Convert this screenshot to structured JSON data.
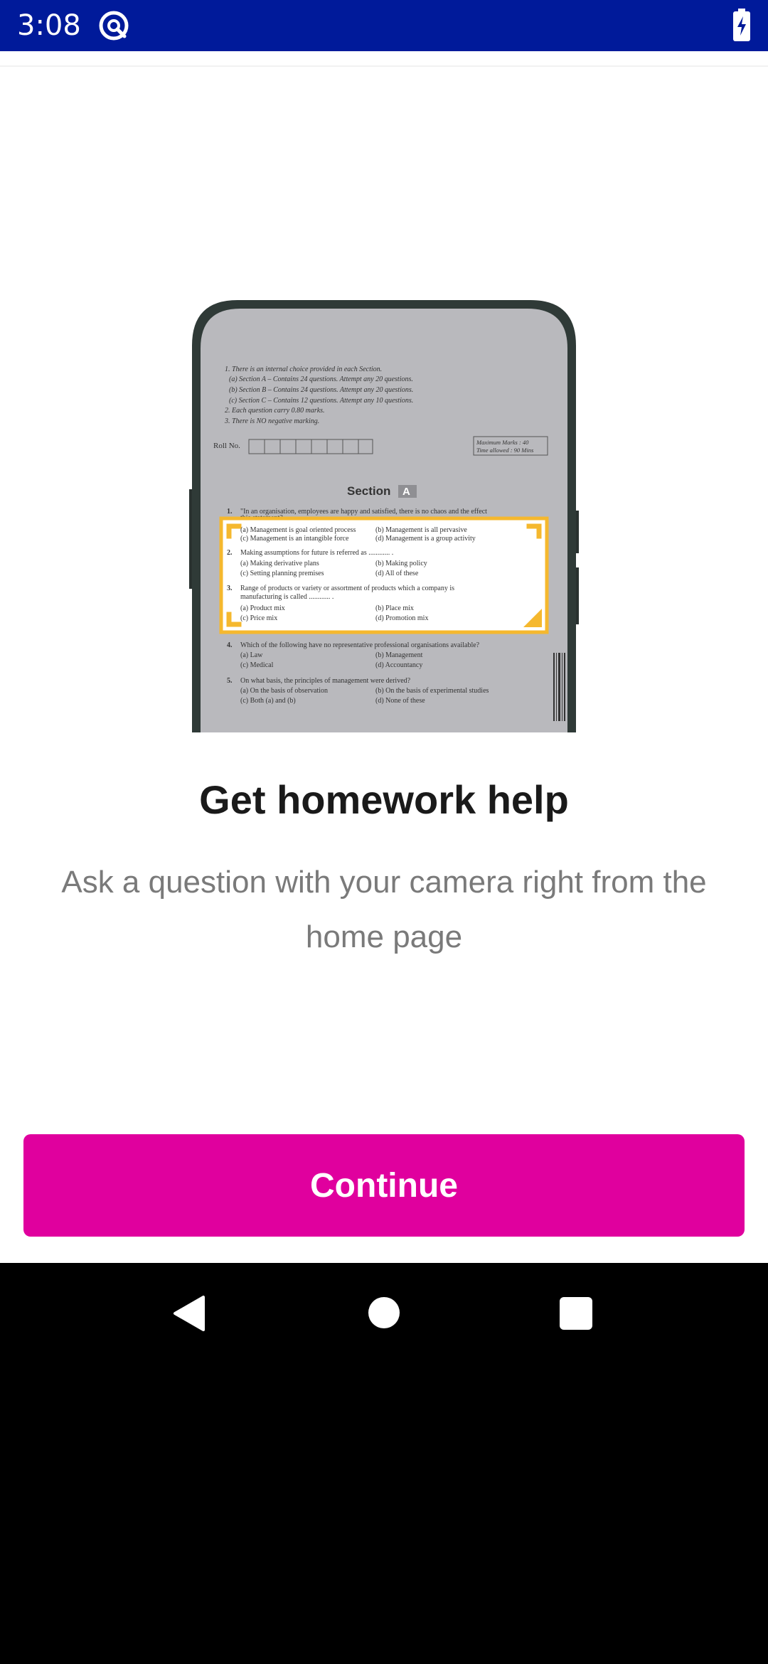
{
  "status_bar": {
    "time": "3:08",
    "icons": [
      "app-notification-icon",
      "battery-charging-icon"
    ],
    "background_color": "#001a9a"
  },
  "illustration": {
    "icon": "phone-scanning-document-illustration",
    "instructions": [
      "1.  There is an internal choice provided in each Section.",
      "(a) Section A – Contains 24 questions. Attempt any 20 questions.",
      "(b) Section B – Contains 24 questions. Attempt any 20 questions.",
      "(c) Section C – Contains 12 questions. Attempt any 10 questions.",
      "2.  Each question carry 0.80 marks.",
      "3.  There is NO negative marking."
    ],
    "roll_no_label": "Roll No.",
    "max_marks": "Maximum Marks : 40",
    "time_allowed": "Time allowed : 90 Mins",
    "section_label": "Section",
    "section_letter": "A",
    "questions": [
      {
        "number": "1.",
        "lines": [
          "\"In an organisation, employees are happy and satisfied, there is no chaos and the effect",
          "this statement?"
        ],
        "options": [
          "(a)  Management is goal oriented process",
          "(b)  Management is all pervasive",
          "(c)  Management is an intangible force",
          "(d)  Management is a group activity"
        ]
      },
      {
        "number": "2.",
        "lines": [
          "Making assumptions for future is referred as ............ ."
        ],
        "options": [
          "(a)  Making derivative plans",
          "(b)  Making policy",
          "(c)  Setting planning premises",
          "(d)  All of these"
        ]
      },
      {
        "number": "3.",
        "lines": [
          "Range of products or variety or assortment of products which a company is",
          "manufacturing is called ............ ."
        ],
        "options": [
          "(a)  Product mix",
          "(b)  Place mix",
          "(c)  Price mix",
          "(d)  Promotion mix"
        ]
      },
      {
        "number": "4.",
        "lines": [
          "Which of the following have no representative professional organisations available?"
        ],
        "options": [
          "(a)  Law",
          "(b)  Management",
          "(c)  Medical",
          "(d)  Accountancy"
        ]
      },
      {
        "number": "5.",
        "lines": [
          "On what basis, the principles of management were derived?"
        ],
        "options": [
          "(a)  On the basis of observation",
          "(b)  On the basis of experimental studies",
          "(c)  Both (a) and (b)",
          "(d)  None of these"
        ]
      }
    ],
    "highlight_color": "#f5b82e"
  },
  "content": {
    "title": "Get homework help",
    "subtitle": "Ask a question with your camera right from the home page"
  },
  "button": {
    "label": "Continue",
    "color": "#e0009e"
  },
  "nav_bar": {
    "icons": [
      "back-icon",
      "home-icon",
      "recents-icon"
    ]
  }
}
